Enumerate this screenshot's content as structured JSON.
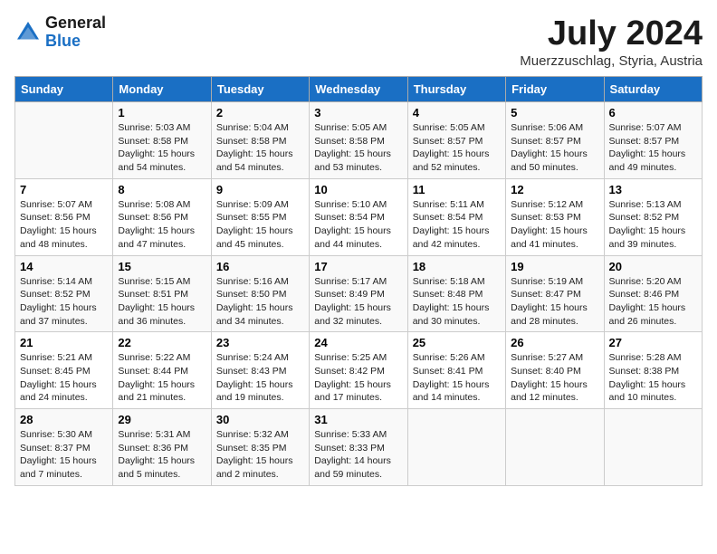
{
  "logo": {
    "general": "General",
    "blue": "Blue"
  },
  "title": "July 2024",
  "subtitle": "Muerzzuschlag, Styria, Austria",
  "weekdays": [
    "Sunday",
    "Monday",
    "Tuesday",
    "Wednesday",
    "Thursday",
    "Friday",
    "Saturday"
  ],
  "weeks": [
    [
      {
        "day": "",
        "info": ""
      },
      {
        "day": "1",
        "info": "Sunrise: 5:03 AM\nSunset: 8:58 PM\nDaylight: 15 hours\nand 54 minutes."
      },
      {
        "day": "2",
        "info": "Sunrise: 5:04 AM\nSunset: 8:58 PM\nDaylight: 15 hours\nand 54 minutes."
      },
      {
        "day": "3",
        "info": "Sunrise: 5:05 AM\nSunset: 8:58 PM\nDaylight: 15 hours\nand 53 minutes."
      },
      {
        "day": "4",
        "info": "Sunrise: 5:05 AM\nSunset: 8:57 PM\nDaylight: 15 hours\nand 52 minutes."
      },
      {
        "day": "5",
        "info": "Sunrise: 5:06 AM\nSunset: 8:57 PM\nDaylight: 15 hours\nand 50 minutes."
      },
      {
        "day": "6",
        "info": "Sunrise: 5:07 AM\nSunset: 8:57 PM\nDaylight: 15 hours\nand 49 minutes."
      }
    ],
    [
      {
        "day": "7",
        "info": "Sunrise: 5:07 AM\nSunset: 8:56 PM\nDaylight: 15 hours\nand 48 minutes."
      },
      {
        "day": "8",
        "info": "Sunrise: 5:08 AM\nSunset: 8:56 PM\nDaylight: 15 hours\nand 47 minutes."
      },
      {
        "day": "9",
        "info": "Sunrise: 5:09 AM\nSunset: 8:55 PM\nDaylight: 15 hours\nand 45 minutes."
      },
      {
        "day": "10",
        "info": "Sunrise: 5:10 AM\nSunset: 8:54 PM\nDaylight: 15 hours\nand 44 minutes."
      },
      {
        "day": "11",
        "info": "Sunrise: 5:11 AM\nSunset: 8:54 PM\nDaylight: 15 hours\nand 42 minutes."
      },
      {
        "day": "12",
        "info": "Sunrise: 5:12 AM\nSunset: 8:53 PM\nDaylight: 15 hours\nand 41 minutes."
      },
      {
        "day": "13",
        "info": "Sunrise: 5:13 AM\nSunset: 8:52 PM\nDaylight: 15 hours\nand 39 minutes."
      }
    ],
    [
      {
        "day": "14",
        "info": "Sunrise: 5:14 AM\nSunset: 8:52 PM\nDaylight: 15 hours\nand 37 minutes."
      },
      {
        "day": "15",
        "info": "Sunrise: 5:15 AM\nSunset: 8:51 PM\nDaylight: 15 hours\nand 36 minutes."
      },
      {
        "day": "16",
        "info": "Sunrise: 5:16 AM\nSunset: 8:50 PM\nDaylight: 15 hours\nand 34 minutes."
      },
      {
        "day": "17",
        "info": "Sunrise: 5:17 AM\nSunset: 8:49 PM\nDaylight: 15 hours\nand 32 minutes."
      },
      {
        "day": "18",
        "info": "Sunrise: 5:18 AM\nSunset: 8:48 PM\nDaylight: 15 hours\nand 30 minutes."
      },
      {
        "day": "19",
        "info": "Sunrise: 5:19 AM\nSunset: 8:47 PM\nDaylight: 15 hours\nand 28 minutes."
      },
      {
        "day": "20",
        "info": "Sunrise: 5:20 AM\nSunset: 8:46 PM\nDaylight: 15 hours\nand 26 minutes."
      }
    ],
    [
      {
        "day": "21",
        "info": "Sunrise: 5:21 AM\nSunset: 8:45 PM\nDaylight: 15 hours\nand 24 minutes."
      },
      {
        "day": "22",
        "info": "Sunrise: 5:22 AM\nSunset: 8:44 PM\nDaylight: 15 hours\nand 21 minutes."
      },
      {
        "day": "23",
        "info": "Sunrise: 5:24 AM\nSunset: 8:43 PM\nDaylight: 15 hours\nand 19 minutes."
      },
      {
        "day": "24",
        "info": "Sunrise: 5:25 AM\nSunset: 8:42 PM\nDaylight: 15 hours\nand 17 minutes."
      },
      {
        "day": "25",
        "info": "Sunrise: 5:26 AM\nSunset: 8:41 PM\nDaylight: 15 hours\nand 14 minutes."
      },
      {
        "day": "26",
        "info": "Sunrise: 5:27 AM\nSunset: 8:40 PM\nDaylight: 15 hours\nand 12 minutes."
      },
      {
        "day": "27",
        "info": "Sunrise: 5:28 AM\nSunset: 8:38 PM\nDaylight: 15 hours\nand 10 minutes."
      }
    ],
    [
      {
        "day": "28",
        "info": "Sunrise: 5:30 AM\nSunset: 8:37 PM\nDaylight: 15 hours\nand 7 minutes."
      },
      {
        "day": "29",
        "info": "Sunrise: 5:31 AM\nSunset: 8:36 PM\nDaylight: 15 hours\nand 5 minutes."
      },
      {
        "day": "30",
        "info": "Sunrise: 5:32 AM\nSunset: 8:35 PM\nDaylight: 15 hours\nand 2 minutes."
      },
      {
        "day": "31",
        "info": "Sunrise: 5:33 AM\nSunset: 8:33 PM\nDaylight: 14 hours\nand 59 minutes."
      },
      {
        "day": "",
        "info": ""
      },
      {
        "day": "",
        "info": ""
      },
      {
        "day": "",
        "info": ""
      }
    ]
  ]
}
